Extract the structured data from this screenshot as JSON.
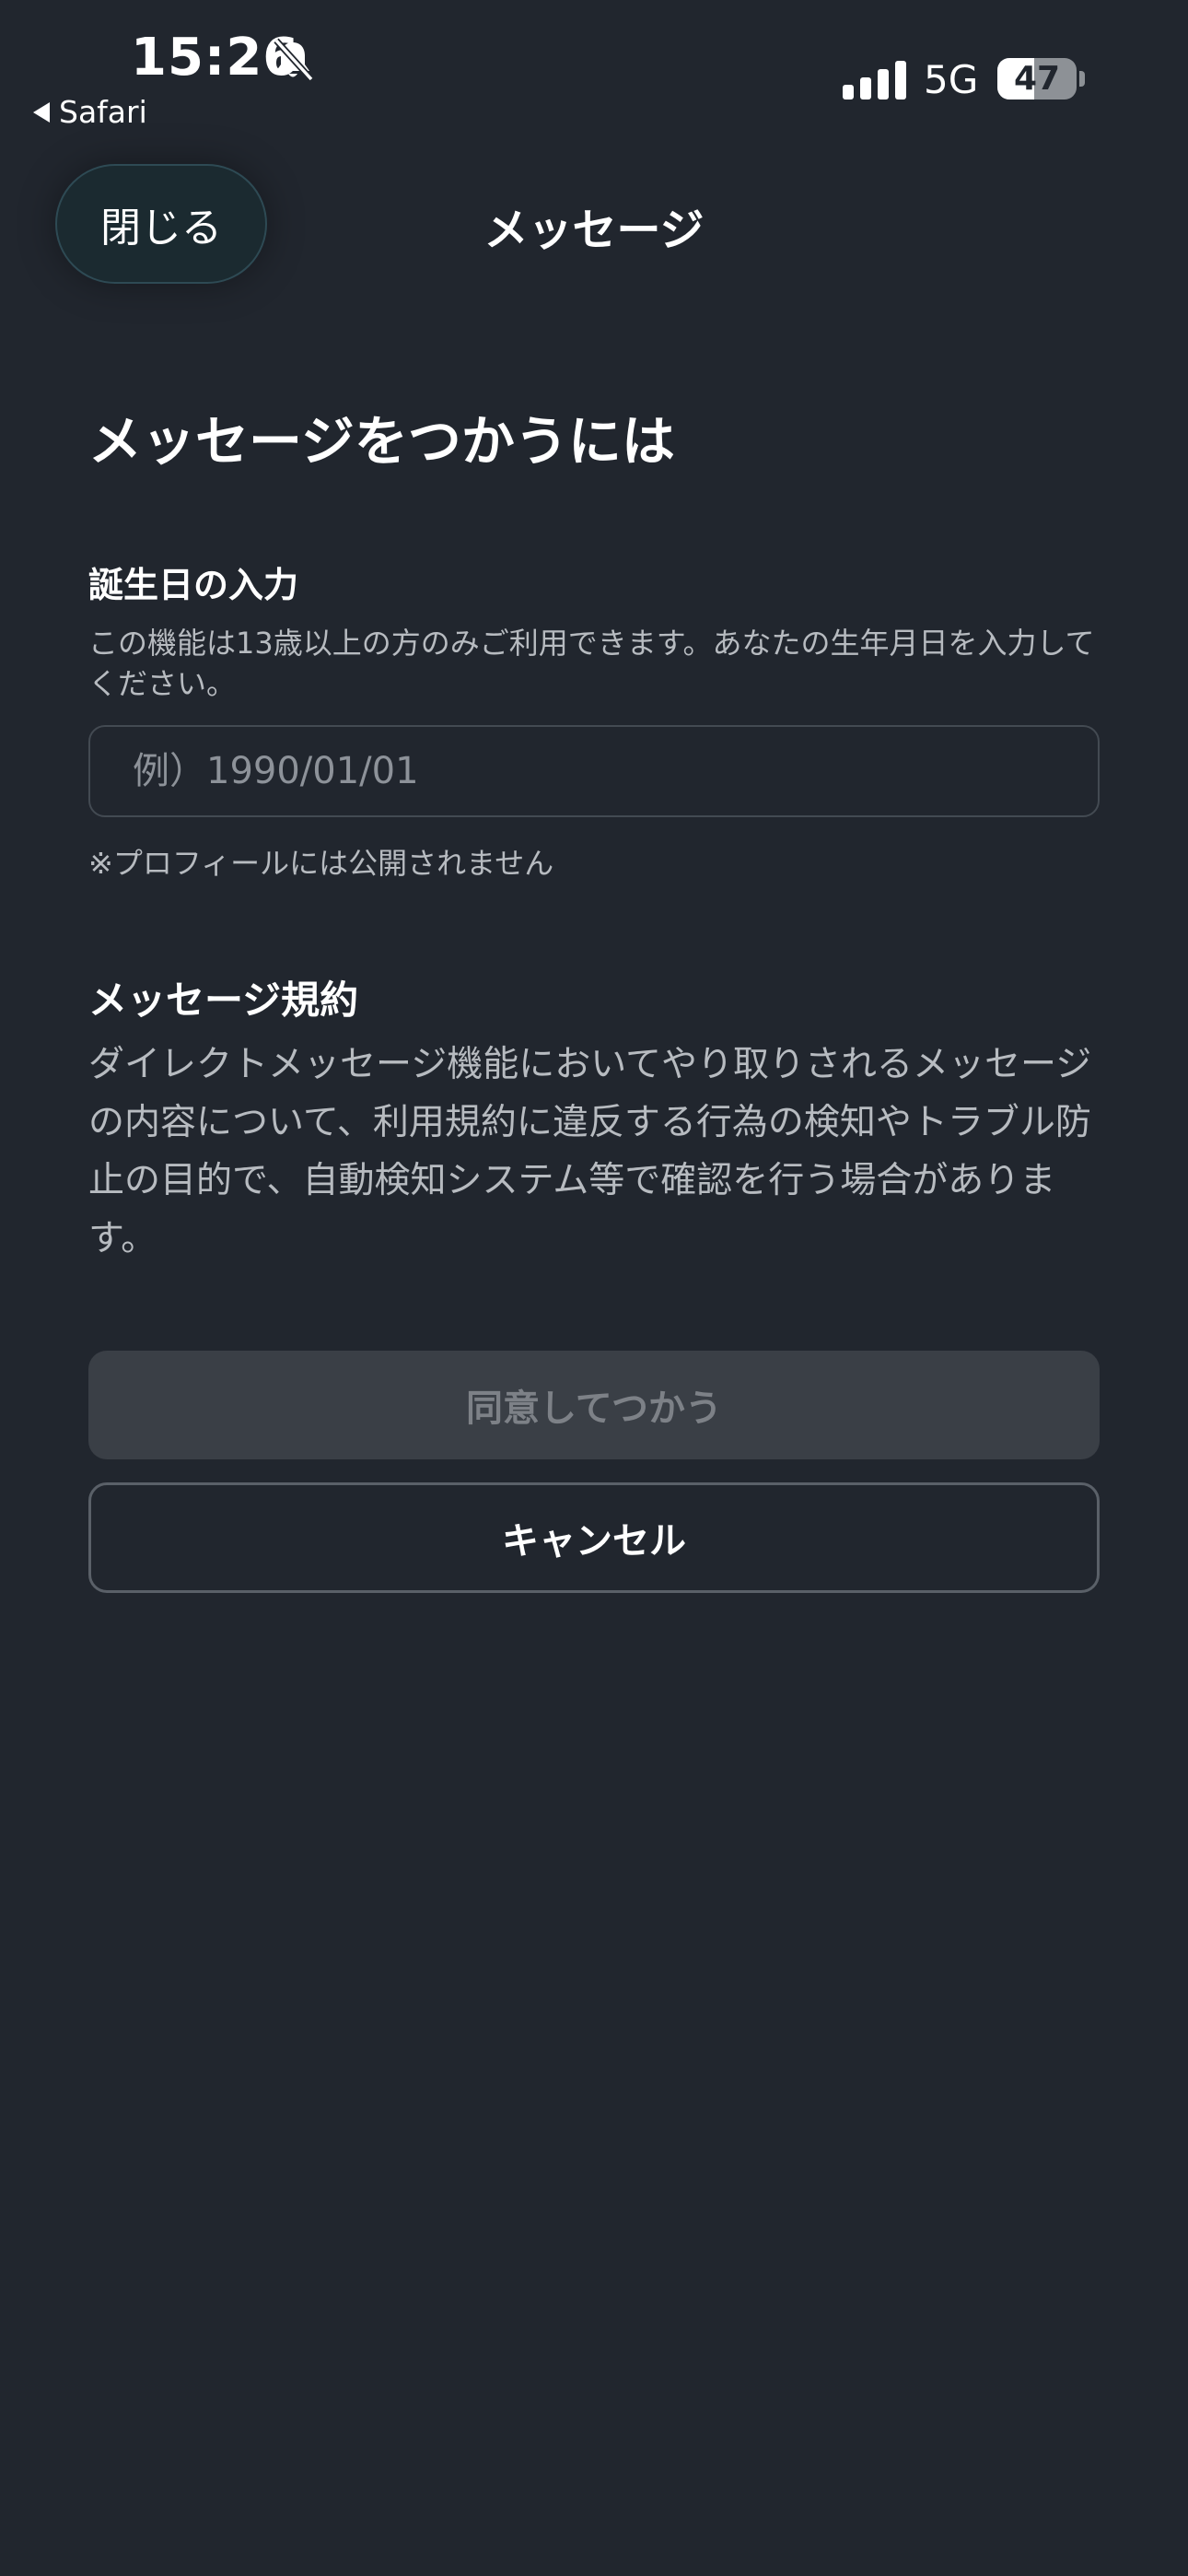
{
  "status_bar": {
    "time": "15:26",
    "back_app": "Safari",
    "network": "5G",
    "battery": "47",
    "battery_level": 0.47
  },
  "header": {
    "close_label": "閉じる",
    "title": "メッセージ"
  },
  "main": {
    "heading": "メッセージをつかうには",
    "birthday": {
      "label": "誕生日の入力",
      "help": "この機能は13歳以上の方のみご利用できます。あなたの生年月日を入力してください。",
      "placeholder": "例）1990/01/01",
      "value": "",
      "note": "※プロフィールには公開されません"
    },
    "terms": {
      "title": "メッセージ規約",
      "body": "ダイレクトメッセージ機能においてやり取りされるメッセージの内容について、利用規約に違反する行為の検知やトラブル防止の目的で、自動検知システム等で確認を行う場合があります。"
    },
    "agree_label": "同意してつかう",
    "cancel_label": "キャンセル"
  },
  "colors": {
    "background": "#21262e",
    "disabled_button": "#3a3f46",
    "secondary_text": "#b7bbc0"
  }
}
